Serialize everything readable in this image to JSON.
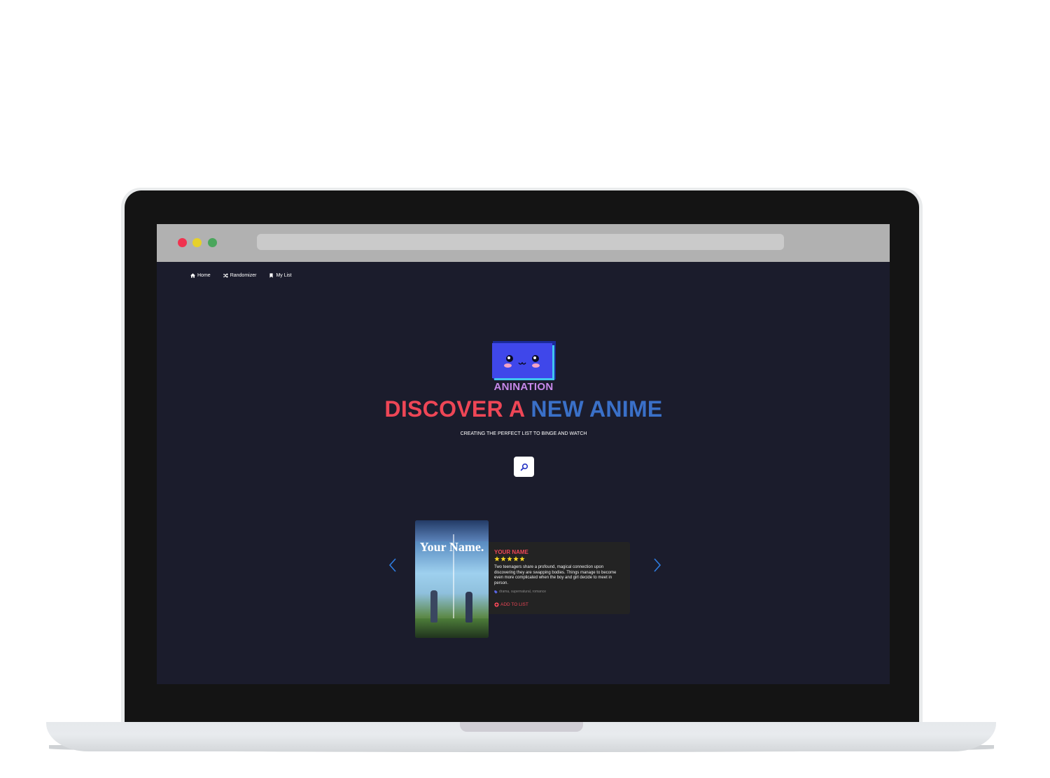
{
  "browser": {
    "traffic_lights": [
      "#f0334f",
      "#e6d12a",
      "#4aa65c"
    ]
  },
  "nav": {
    "items": [
      {
        "label": "Home",
        "icon": "home-icon"
      },
      {
        "label": "Randomizer",
        "icon": "shuffle-icon"
      },
      {
        "label": "My List",
        "icon": "bookmark-icon"
      }
    ]
  },
  "hero": {
    "brand": "ANINATION",
    "headline_part1": "DISCOVER A",
    "headline_part2": "NEW ANIME",
    "subtitle": "CREATING THE PERFECT LIST TO BINGE AND WATCH",
    "search_icon": "search-icon"
  },
  "featured": {
    "poster_title": "Your Name.",
    "title": "YOUR NAME",
    "rating": 5,
    "description": "Two teenagers share a profound, magical connection upon discovering they are swapping bodies. Things manage to become even more complicated when the boy and girl decide to meet in person.",
    "tags": "drama, supernatural, romance",
    "add_label": "ADD TO LIST"
  },
  "colors": {
    "screen_bg": "#1b1c2c",
    "accent_red": "#ee4656",
    "accent_blue": "#3a70c8",
    "brand_purple": "#c789ea",
    "star_yellow": "#f5d423",
    "arrow_blue": "#2f7de1"
  }
}
